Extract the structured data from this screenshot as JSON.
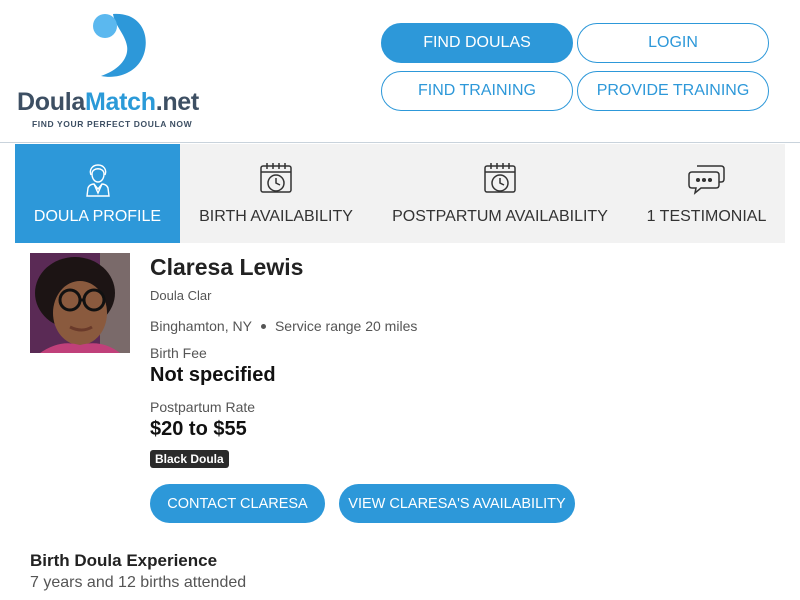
{
  "brand": {
    "name_doula": "Doula",
    "name_match": "Match",
    "name_net": ".net",
    "tagline": "FIND YOUR PERFECT DOULA NOW",
    "colors": {
      "primary": "#2d98d9",
      "dark": "#3d4f63",
      "light": "#5bb8ef"
    }
  },
  "nav": {
    "find_doulas": "FIND DOULAS",
    "login": "LOGIN",
    "find_training": "FIND TRAINING",
    "provide_training": "PROVIDE TRAINING"
  },
  "tabs": [
    {
      "label": "DOULA PROFILE",
      "icon": "doula-person-icon",
      "active": true
    },
    {
      "label": "BIRTH AVAILABILITY",
      "icon": "calendar-clock-icon",
      "active": false
    },
    {
      "label": "POSTPARTUM AVAILABILITY",
      "icon": "calendar-clock-icon",
      "active": false
    },
    {
      "label": "1 TESTIMONIAL",
      "icon": "speech-bubbles-icon",
      "active": false
    }
  ],
  "profile": {
    "name": "Claresa Lewis",
    "subtitle": "Doula Clar",
    "location": "Binghamton, NY",
    "service_range": "Service range 20 miles",
    "birth_fee_label": "Birth Fee",
    "birth_fee_value": "Not specified",
    "postpartum_rate_label": "Postpartum Rate",
    "postpartum_rate_value": "$20 to $55",
    "badge": "Black Doula",
    "contact_button": "CONTACT CLARESA",
    "availability_button": "VIEW CLARESA'S AVAILABILITY"
  },
  "experience": {
    "title": "Birth Doula Experience",
    "text": "7 years and 12 births attended"
  }
}
